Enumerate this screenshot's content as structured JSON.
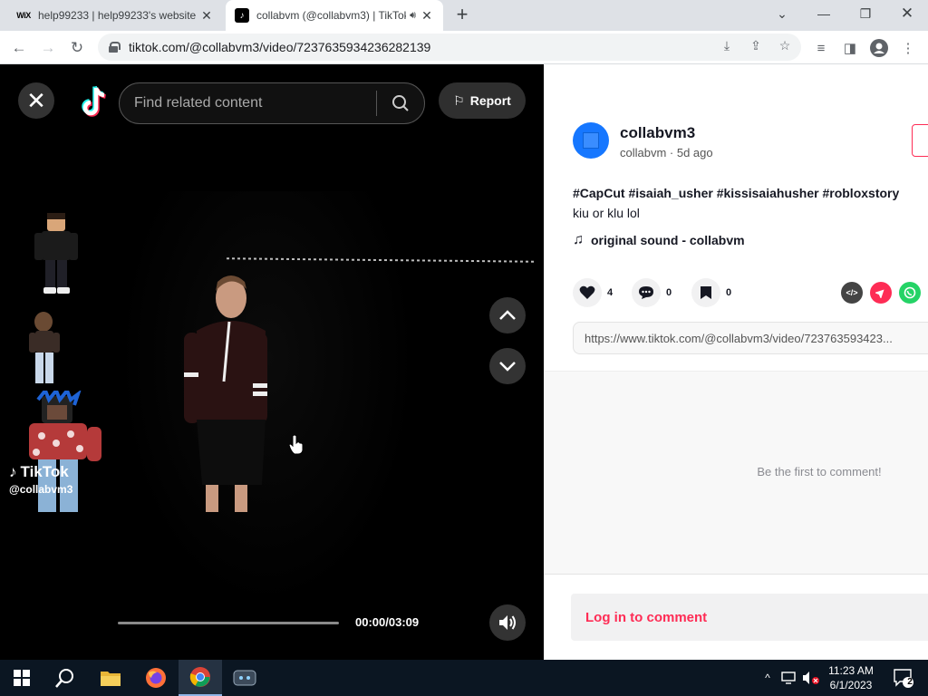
{
  "browser": {
    "tabs": [
      {
        "favicon": "WiX",
        "title": "help99233 | help99233's website",
        "active": false
      },
      {
        "favicon": "tiktok-icon",
        "title": "collabvm (@collabvm3) | TikTok",
        "active": true
      }
    ],
    "url": "tiktok.com/@collabvm3/video/7237635934236282139"
  },
  "video": {
    "search_placeholder": "Find related content",
    "report_label": "Report",
    "watermark_brand": "TikTok",
    "watermark_handle": "@collabvm3",
    "time": "00:00/03:09",
    "progress": 0
  },
  "post": {
    "username": "collabvm3",
    "subtitle": "collabvm · 5d ago",
    "hashtags": "#CapCut #isaiah_usher #kissisaiahusher #robloxstory",
    "caption": "kiu or klu lol",
    "music": "original sound - collabvm",
    "likes": "4",
    "comments": "0",
    "saves": "0",
    "link": "https://www.tiktok.com/@collabvm3/video/723763593423...",
    "empty_comments": "Be the first to comment!",
    "login_prompt": "Log in to comment"
  },
  "taskbar": {
    "time": "11:23 AM",
    "date": "6/1/2023",
    "notifications": "2"
  },
  "colors": {
    "tiktok_red": "#fe2c55",
    "tiktok_cyan": "#25f4ee",
    "taskbar": "#0b1622"
  }
}
